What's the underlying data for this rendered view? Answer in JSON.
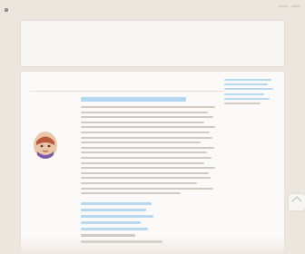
{
  "site": {
    "logo_label": "",
    "logo_icon": "site-logo-icon"
  },
  "header": {
    "title": ""
  },
  "content": {
    "section_title": "",
    "entry1": {
      "link_text": ""
    },
    "sidebar": {
      "title": ""
    }
  },
  "colors": {
    "background": "#ece6df",
    "card": "#fbfaf8",
    "link": "#3b8fc8",
    "link_blur": "#b3d7ee",
    "text_blur": "#cfcac4"
  },
  "icons": {
    "avatar": "avatar-icon",
    "scroll_top": "scroll-to-top-icon"
  }
}
